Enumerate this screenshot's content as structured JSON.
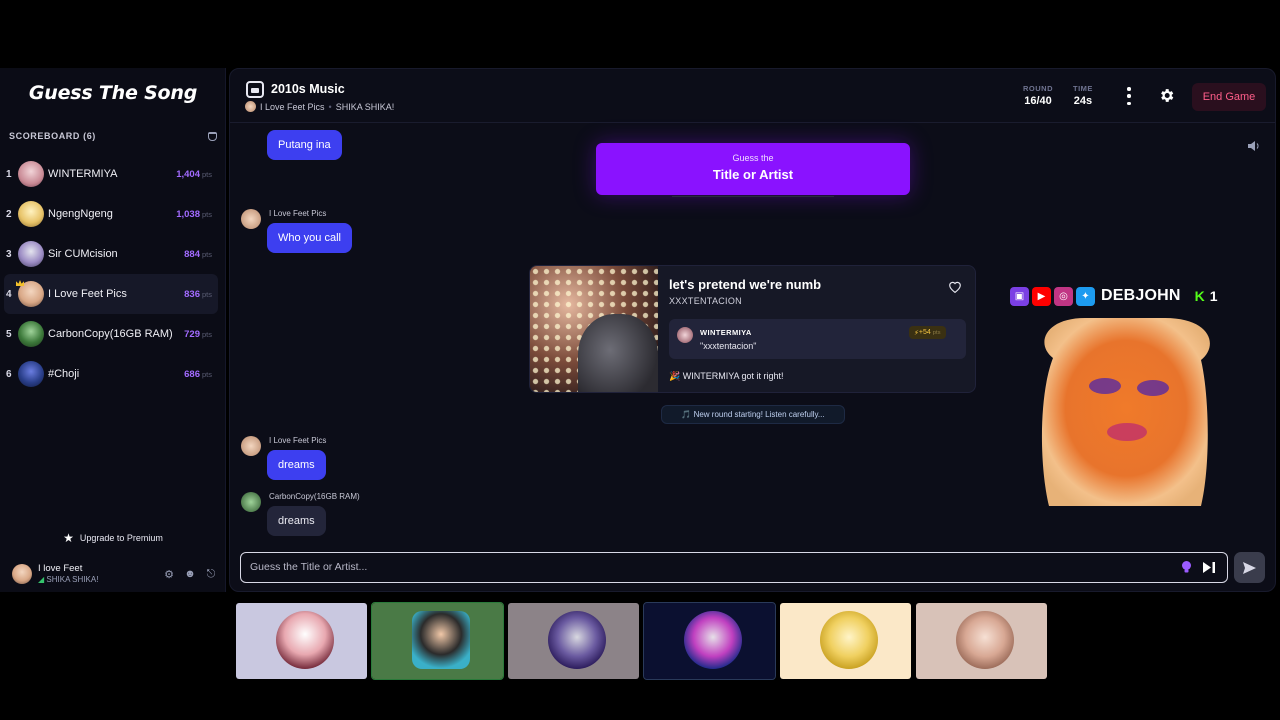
{
  "brand": "Guess The Song",
  "scoreboard": {
    "title": "SCOREBOARD (6)",
    "players": [
      {
        "rank": "1",
        "name": "WINTERMIYA",
        "points": "1,404",
        "unit": "pts",
        "color": "#c9a2a8"
      },
      {
        "rank": "2",
        "name": "NgengNgeng",
        "points": "1,038",
        "unit": "pts",
        "color": "#e8c46a"
      },
      {
        "rank": "3",
        "name": "Sir CUMcision",
        "points": "884",
        "unit": "pts",
        "color": "#9c8cc4"
      },
      {
        "rank": "4",
        "name": "I Love Feet Pics",
        "points": "836",
        "unit": "pts",
        "color": "#d9a887"
      },
      {
        "rank": "5",
        "name": "CarbonCopy(16GB RAM)",
        "points": "729",
        "unit": "pts",
        "color": "#3d7a3b"
      },
      {
        "rank": "6",
        "name": "#Choji",
        "points": "686",
        "unit": "pts",
        "color": "#2a3f8a"
      }
    ]
  },
  "upgrade_label": "Upgrade to Premium",
  "me": {
    "name": "I love Feet",
    "team": "SHIKA SHIKA!"
  },
  "header": {
    "playlist_title": "2010s Music",
    "host": "I Love Feet Pics",
    "team": "SHIKA SHIKA!",
    "round_label": "ROUND",
    "round_value": "16/40",
    "time_label": "TIME",
    "time_value": "24s",
    "end_game": "End Game"
  },
  "guess_prompt": {
    "line1": "Guess the",
    "line2": "Title or Artist"
  },
  "chat": [
    {
      "text": "Putang ina"
    },
    {
      "user": "I Love Feet Pics",
      "text": "Who you call"
    },
    {
      "user": "I Love Feet Pics",
      "text": "dreams"
    },
    {
      "user": "CarbonCopy(16GB RAM)",
      "text": "dreams"
    }
  ],
  "reveal": {
    "title": "let's pretend we're numb",
    "artist": "XXXTENTACION",
    "answer_user": "WINTERMIYA",
    "answer_text": "\"xxxtentacion\"",
    "gain": "+54",
    "gain_unit": "pts",
    "got_it": "🎉 WINTERMIYA got it right!"
  },
  "new_round": "🎵 New round starting! Listen carefully...",
  "streamer": {
    "name": "DEBJOHN",
    "kick_count": "1"
  },
  "composer": {
    "placeholder": "Guess the Title or Artist..."
  },
  "colors": {
    "accent": "#8a12ff",
    "bubble": "#3d3ff0",
    "points": "#a26bff",
    "danger": "#ff5e8a"
  }
}
